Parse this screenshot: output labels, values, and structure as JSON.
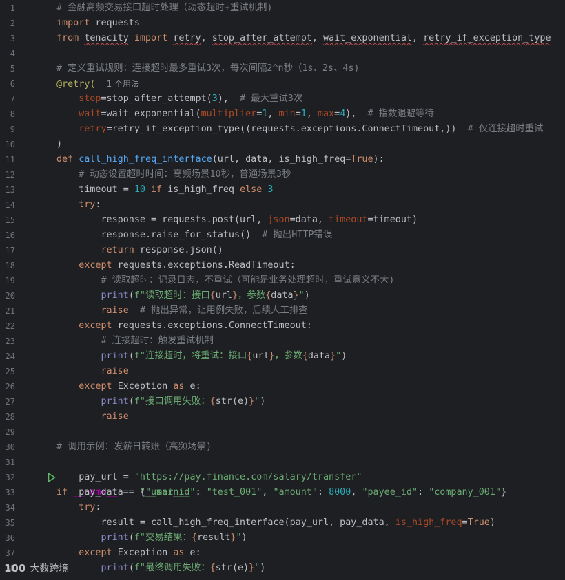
{
  "editor": {
    "line_numbers": [
      "1",
      "2",
      "3",
      "4",
      "5",
      "6",
      "7",
      "8",
      "9",
      "10",
      "11",
      "12",
      "13",
      "14",
      "15",
      "16",
      "17",
      "18",
      "19",
      "20",
      "21",
      "22",
      "23",
      "24",
      "25",
      "26",
      "27",
      "28",
      "29",
      "30",
      "31",
      "32",
      "33",
      "34",
      "35",
      "36",
      "37",
      "38"
    ],
    "code": {
      "c1": "# 金融高频交易接口超时处理（动态超时+重试机制)",
      "l2_kw": "import",
      "l2_rest": " requests",
      "l3_kw1": "from",
      "l3_mod": "tenacity",
      "l3_kw2": "import",
      "l3_n1": "retry",
      "l3_n2": "stop_after_attempt",
      "l3_n3": "wait_exponential",
      "l3_n4": "retry_if_exception_type",
      "c5": "# 定义重试规则：连接超时最多重试3次，每次间隔2^n秒（1s、2s、4s)",
      "l6_dec": "@retry(",
      "l6_hint": "1 个用法",
      "l7_p": "stop",
      "l7_a": "=stop_after_attempt(",
      "l7_n": "3",
      "l7_b": "),  ",
      "l7_c": "# 最大重试3次",
      "l8_p": "wait",
      "l8_a": "=wait_exponential(",
      "l8_p1": "multiplier",
      "l8_n1": "1",
      "l8_p2": "min",
      "l8_n2": "1",
      "l8_p3": "max",
      "l8_n3": "4",
      "l8_c": "# 指数退避等待",
      "l9_p": "retry",
      "l9_a": "=retry_if_exception_type((requests.exceptions.ConnectTimeout,))  ",
      "l9_c": "# 仅连接超时重试",
      "l10": ")",
      "l11_kw": "def",
      "l11_fn": "call_high_freq_interface",
      "l11_a": "(url, data, is_high_freq=",
      "l11_t": "True",
      "l11_b": "):",
      "c12": "# 动态设置超时时间：高频场景10秒，普通场景3秒",
      "l13_a": "timeout = ",
      "l13_n1": "10",
      "l13_kw1": "if",
      "l13_b": " is_high_freq ",
      "l13_kw2": "else",
      "l13_n2": "3",
      "l14_kw": "try",
      "l15_a": "response = requests.post(url, ",
      "l15_p1": "json",
      "l15_b": "=data, ",
      "l15_p2": "timeout",
      "l15_c": "=timeout)",
      "l16_a": "response.raise_for_status()  ",
      "l16_c": "# 抛出HTTP错误",
      "l17_kw": "return",
      "l17_a": " response.json()",
      "l18_kw": "except",
      "l18_a": " requests.exceptions.ReadTimeout:",
      "c19": "# 读取超时：记录日志，不重试（可能是业务处理超时，重试意义不大)",
      "l20_bi": "print",
      "l20_s1": "f\"读取超时：接口",
      "l20_v1": "url",
      "l20_s2": "，参数",
      "l20_v2": "data",
      "l20_s3": "\"",
      "l21_kw": "raise",
      "l21_c": "# 抛出异常，让用例失败，后续人工排查",
      "l22_kw": "except",
      "l22_a": " requests.exceptions.ConnectTimeout:",
      "c23": "# 连接超时：触发重试机制",
      "l24_bi": "print",
      "l24_s1": "f\"连接超时，将重试：接口",
      "l24_v1": "url",
      "l24_s2": "，参数",
      "l24_v2": "data",
      "l24_s3": "\"",
      "l25_kw": "raise",
      "l26_kw1": "except",
      "l26_ex": "Exception",
      "l26_kw2": "as",
      "l26_v": "e",
      "l27_bi": "print",
      "l27_s1": "f\"接口调用失败：",
      "l27_v": "str(e)",
      "l27_s2": "\"",
      "l28_kw": "raise",
      "c30": "# 调用示例：发薪日转账（高频场景)",
      "l31_kw": "if",
      "l31_dn": "__name__",
      "l31_a": " == ",
      "l31_s": "\"__main__\"",
      "l32_a": "pay_url = ",
      "l32_s": "\"https://pay.finance.com/salary/transfer\"",
      "l33_a": "pay_data = {",
      "l33_s1": "\"user_id\"",
      "l33_s2": "\"test_001\"",
      "l33_s3": "\"amount\"",
      "l33_n": "8000",
      "l33_s4": "\"payee_id\"",
      "l33_s5": "\"company_001\"",
      "l34_kw": "try",
      "l35_a": "result = call_high_freq_interface(pay_url, pay_data, ",
      "l35_p": "is_high_freq",
      "l35_t": "True",
      "l36_bi": "print",
      "l36_s1": "f\"交易结果：",
      "l36_v": "result",
      "l36_s2": "\"",
      "l37_kw1": "except",
      "l37_ex": "Exception",
      "l37_kw2": "as",
      "l37_v": "e",
      "l38_bi": "print",
      "l38_s1": "f\"最终调用失败：",
      "l38_v": "str(e)",
      "l38_s2": "\""
    }
  },
  "watermark": {
    "logo": "100",
    "text": "大数跨境"
  },
  "colors": {
    "background": "#1e1f22",
    "keyword": "#cf8e6d",
    "function": "#56a8f5",
    "string": "#6aab73",
    "number": "#2aacb8",
    "comment": "#7a7e85",
    "param": "#aa4926",
    "run_icon": "#5fb865"
  },
  "icons": {
    "run_gutter": "play-triangle-icon"
  }
}
